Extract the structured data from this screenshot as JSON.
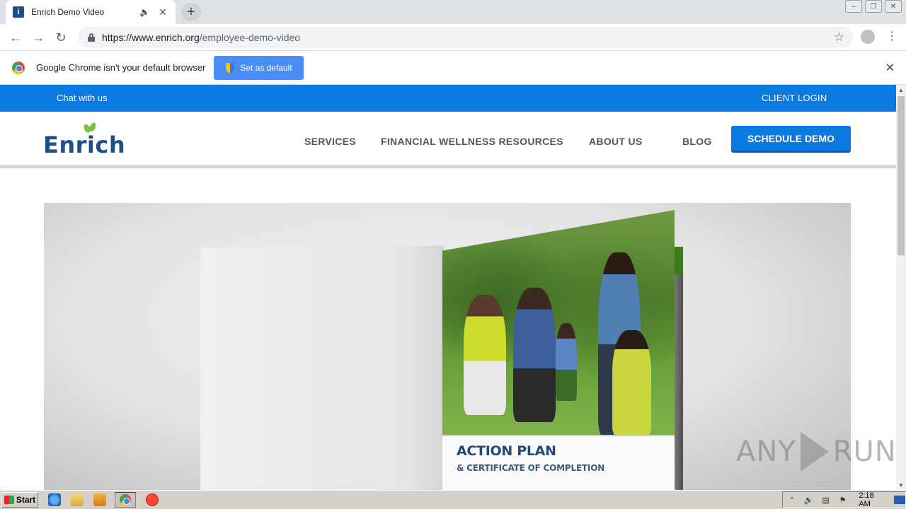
{
  "browser": {
    "tab": {
      "title": "Enrich Demo Video"
    },
    "url": {
      "host": "https://www.enrich.org",
      "path": "/employee-demo-video"
    },
    "infobar": {
      "message": "Google Chrome isn't your default browser",
      "button_label": "Set as default"
    }
  },
  "site": {
    "topbar": {
      "chat": "Chat with us",
      "login": "CLIENT LOGIN"
    },
    "logo_text": "Enrich",
    "nav": {
      "services": "SERVICES",
      "resources": "FINANCIAL WELLNESS RESOURCES",
      "about": "ABOUT US",
      "blog": "BLOG"
    },
    "cta_label": "SCHEDULE DEMO",
    "colors": {
      "brand_blue": "#0a7ae0",
      "logo_blue": "#1f4e8c",
      "leaf_green": "#7cc142"
    }
  },
  "video": {
    "caption_title": "ACTION PLAN",
    "caption_subtitle": "& CERTIFICATE OF COMPLETION"
  },
  "watermark": {
    "text": "ANY",
    "text2": "RUN"
  },
  "taskbar": {
    "start_label": "Start",
    "clock": "2:18 AM"
  }
}
